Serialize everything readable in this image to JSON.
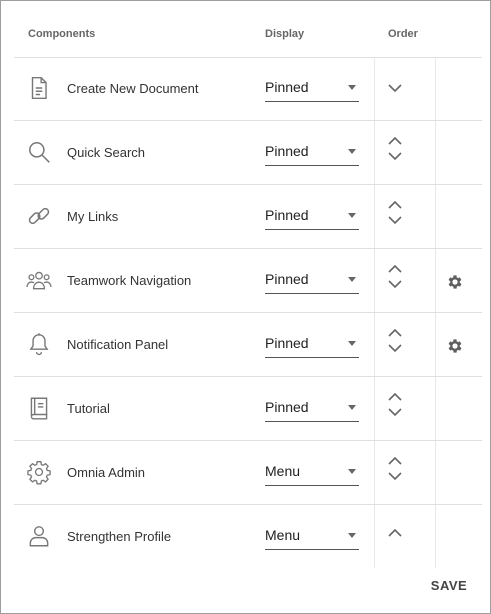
{
  "header": {
    "components_label": "Components",
    "display_label": "Display",
    "order_label": "Order"
  },
  "rows": [
    {
      "label": "Create New Document",
      "icon": "document-icon",
      "display": "Pinned",
      "order": [
        "down"
      ],
      "settings": false
    },
    {
      "label": "Quick Search",
      "icon": "search-icon",
      "display": "Pinned",
      "order": [
        "up",
        "down"
      ],
      "settings": false
    },
    {
      "label": "My Links",
      "icon": "link-icon",
      "display": "Pinned",
      "order": [
        "up",
        "down"
      ],
      "settings": false
    },
    {
      "label": "Teamwork Navigation",
      "icon": "people-icon",
      "display": "Pinned",
      "order": [
        "up",
        "down"
      ],
      "settings": true
    },
    {
      "label": "Notification Panel",
      "icon": "bell-icon",
      "display": "Pinned",
      "order": [
        "up",
        "down"
      ],
      "settings": true
    },
    {
      "label": "Tutorial",
      "icon": "book-icon",
      "display": "Pinned",
      "order": [
        "up",
        "down"
      ],
      "settings": false
    },
    {
      "label": "Omnia Admin",
      "icon": "gear-outline-icon",
      "display": "Menu",
      "order": [
        "up",
        "down"
      ],
      "settings": false
    },
    {
      "label": "Strengthen Profile",
      "icon": "person-icon",
      "display": "Menu",
      "order": [
        "up"
      ],
      "settings": false
    }
  ],
  "save_label": "SAVE",
  "colors": {
    "icon": "#777777",
    "settings_icon": "#5f5f5f",
    "divider": "#e0e0e0",
    "border": "#9e9e9e"
  }
}
